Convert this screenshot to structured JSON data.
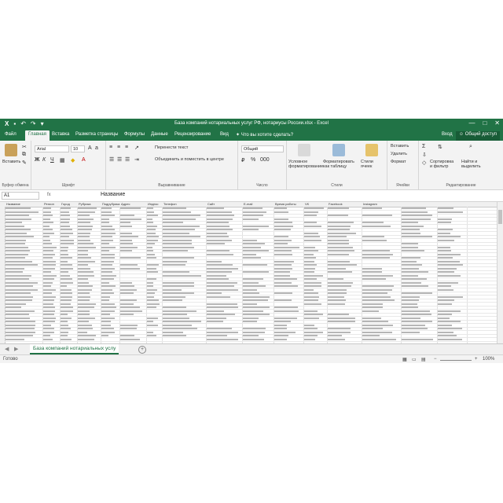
{
  "window": {
    "title": "База компаний нотариальных услуг РФ, нотариусы России.xlsx - Excel",
    "minimize": "—",
    "maximize": "□",
    "close": "✕"
  },
  "quick_access": [
    "save-icon",
    "undo-icon",
    "redo-icon"
  ],
  "tabs": [
    "Файл",
    "Главная",
    "Вставка",
    "Разметка страницы",
    "Формулы",
    "Данные",
    "Рецензирование",
    "Вид",
    "Что вы хотите сделать?"
  ],
  "account": {
    "signin": "Вход",
    "share": "Общий доступ"
  },
  "ribbon": {
    "clipboard": {
      "paste": "Вставить",
      "label": "Буфер обмена"
    },
    "font": {
      "name": "Arial",
      "size": "10",
      "label": "Шрифт"
    },
    "alignment": {
      "wrap": "Перенести текст",
      "merge": "Объединить и поместить в центре",
      "label": "Выравнивание"
    },
    "number": {
      "format": "Общий",
      "label": "Число"
    },
    "styles": {
      "conditional": "Условное форматирование",
      "as_table": "Форматировать как таблицу",
      "cell_styles": "Стили ячеек",
      "label": "Стили"
    },
    "cells": {
      "insert": "Вставить",
      "delete": "Удалить",
      "format": "Формат",
      "label": "Ячейки"
    },
    "editing": {
      "sort": "Сортировка и фильтр",
      "find": "Найти и выделить",
      "label": "Редактирование"
    }
  },
  "formula_bar": {
    "cell_ref": "A1",
    "fx": "fx",
    "content": "Название"
  },
  "grid": {
    "columns": [
      "Название",
      "Регион",
      "Город",
      "Рубрика",
      "Подрубрика",
      "Адрес",
      "Индекс",
      "Телефон",
      "Сайт",
      "E-mail",
      "Время работы",
      "VK",
      "Facebook",
      "Instagram"
    ],
    "row_count": 38
  },
  "sheet": {
    "name": "База компаний нотариальных услу",
    "add": "+"
  },
  "status": {
    "ready": "Готово",
    "zoom": "100%"
  }
}
